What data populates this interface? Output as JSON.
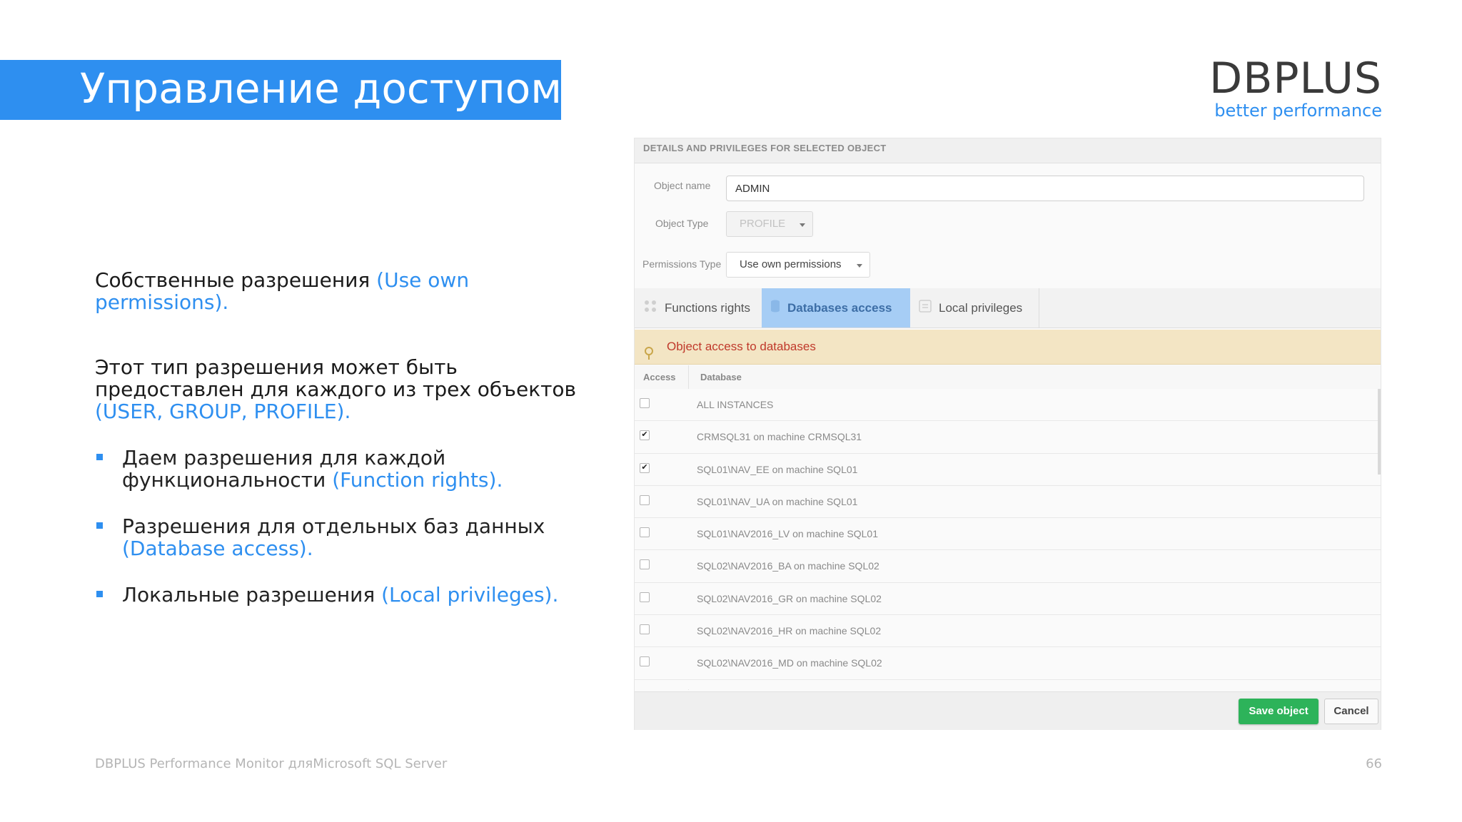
{
  "slide": {
    "title": "Управление доступом",
    "logo": {
      "name": "DBPLUS",
      "tagline": "better performance"
    },
    "para1": {
      "text": "Собственные разрешения ",
      "highlight": "(Use own permissions)."
    },
    "para2": {
      "text": "Этот тип разрешения может быть предоставлен для каждого из трех объектов ",
      "highlight": "(USER, GROUP, PROFILE)."
    },
    "bullets": [
      {
        "text": "Даем разрешения для каждой функциональности ",
        "highlight": "(Function rights)."
      },
      {
        "text": "Разрешения для отдельных баз данных ",
        "highlight": "(Database access)."
      },
      {
        "text": "Локальные разрешения ",
        "highlight": "(Local privileges)."
      }
    ],
    "footer": "DBPLUS Performance Monitor дляMicrosoft SQL Server",
    "page_number": "66",
    "colors": {
      "accent": "#2e8ff0",
      "save_button": "#2db35a",
      "active_tab": "#a6cdf5",
      "alert_bg": "#f3e5c4"
    }
  },
  "app": {
    "header": "DETAILS AND PRIVILEGES FOR SELECTED OBJECT",
    "object_name": {
      "label": "Object name",
      "value": "ADMIN"
    },
    "object_type": {
      "label": "Object Type",
      "value": "PROFILE"
    },
    "permissions_type": {
      "label": "Permissions Type",
      "value": "Use own permissions"
    },
    "tabs": [
      {
        "label": "Functions rights",
        "icon": "functions-icon",
        "active": false
      },
      {
        "label": "Databases access",
        "icon": "database-icon",
        "active": true
      },
      {
        "label": "Local privileges",
        "icon": "list-icon",
        "active": false
      }
    ],
    "alert": {
      "icon": "pin-icon",
      "text": "Object access to databases"
    },
    "table": {
      "columns": [
        "Access",
        "Database"
      ],
      "rows": [
        {
          "checked": false,
          "database": "ALL INSTANCES"
        },
        {
          "checked": true,
          "database": "CRMSQL31 on machine CRMSQL31"
        },
        {
          "checked": true,
          "database": "SQL01\\NAV_EE on machine SQL01"
        },
        {
          "checked": false,
          "database": "SQL01\\NAV_UA on machine SQL01"
        },
        {
          "checked": false,
          "database": "SQL01\\NAV2016_LV on machine SQL01"
        },
        {
          "checked": false,
          "database": "SQL02\\NAV2016_BA on machine SQL02"
        },
        {
          "checked": false,
          "database": "SQL02\\NAV2016_GR on machine SQL02"
        },
        {
          "checked": false,
          "database": "SQL02\\NAV2016_HR on machine SQL02"
        },
        {
          "checked": false,
          "database": "SQL02\\NAV2016_MD on machine SQL02"
        },
        {
          "checked": false,
          "database": ""
        }
      ]
    },
    "buttons": {
      "save": "Save object",
      "cancel": "Cancel"
    }
  }
}
